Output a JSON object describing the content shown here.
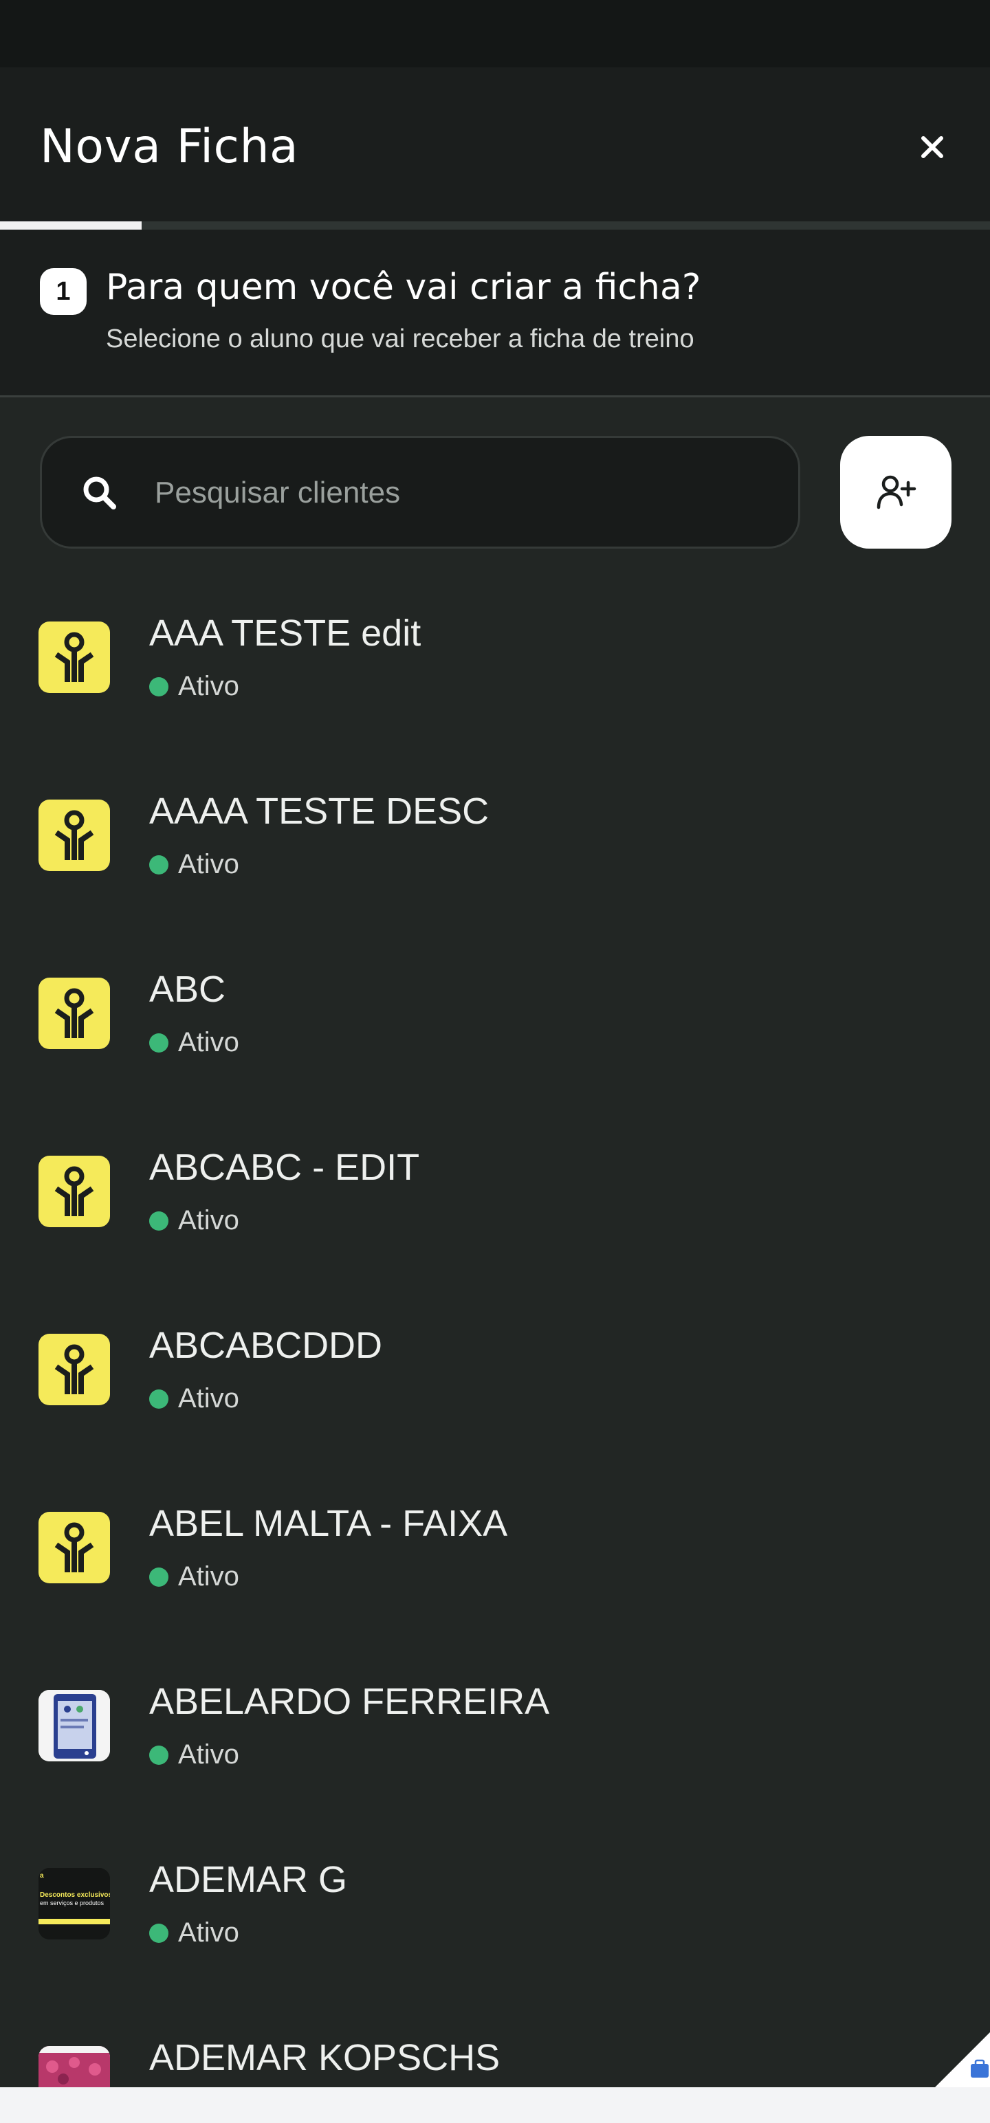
{
  "header": {
    "title": "Nova Ficha"
  },
  "step": {
    "number": "1",
    "title": "Para quem você vai criar a ficha?",
    "subtitle": "Selecione o aluno que vai receber a ficha de treino"
  },
  "progress": {
    "value": 0.143
  },
  "search": {
    "placeholder": "Pesquisar clientes",
    "value": ""
  },
  "clients": [
    {
      "name": "AAA TESTE edit",
      "status": "Ativo",
      "avatar": "logo"
    },
    {
      "name": "AAAA TESTE DESC",
      "status": "Ativo",
      "avatar": "logo"
    },
    {
      "name": "ABC",
      "status": "Ativo",
      "avatar": "logo"
    },
    {
      "name": "ABCABC - EDIT",
      "status": "Ativo",
      "avatar": "logo"
    },
    {
      "name": "ABCABCDDD",
      "status": "Ativo",
      "avatar": "logo"
    },
    {
      "name": "ABEL MALTA - FAIXA",
      "status": "Ativo",
      "avatar": "logo"
    },
    {
      "name": "ABELARDO FERREIRA",
      "status": "Ativo",
      "avatar": "photo"
    },
    {
      "name": "ADEMAR G",
      "status": "Ativo",
      "avatar": "photo"
    },
    {
      "name": "ADEMAR KOPSCHS",
      "status": "",
      "avatar": "photo"
    }
  ],
  "avatar_photo_text": {
    "line1": "Descontos exclusivos",
    "line2": "em serviços e produtos"
  },
  "icons": {
    "close": "close-icon",
    "search": "search-icon",
    "add_user": "add-user-icon",
    "brand_logo": "brand-logo-icon",
    "status_active": "status-dot-icon"
  },
  "colors": {
    "background": "#222624",
    "header": "#1b1e1d",
    "accent_yellow": "#f5ea5a",
    "status_active": "#3cb878"
  }
}
